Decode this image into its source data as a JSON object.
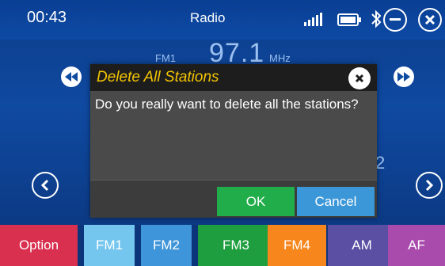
{
  "status_bar": {
    "time": "00:43",
    "title": "Radio",
    "icons": [
      "signal-icon",
      "battery-icon",
      "bluetooth-icon",
      "minimize-icon",
      "close-icon"
    ]
  },
  "radio": {
    "band": "FM1",
    "frequency": "97.1",
    "unit": "MHz",
    "bg_digit": "2"
  },
  "dialog": {
    "title": "Delete All Stations",
    "message": "Do you really want to delete all the stations?",
    "ok_label": "OK",
    "cancel_label": "Cancel"
  },
  "tabs": [
    {
      "label": "Option",
      "color": "#d9304f"
    },
    {
      "label": "FM1",
      "color": "#74c6ef",
      "selected": true
    },
    {
      "label": "FM2",
      "color": "#3f95d9"
    },
    {
      "label": "FM3",
      "color": "#1e9e3f"
    },
    {
      "label": "FM4",
      "color": "#f7861c"
    },
    {
      "label": "AM",
      "color": "#5b4fa4"
    },
    {
      "label": "AF",
      "color": "#a84bad"
    }
  ],
  "colors": {
    "title_accent": "#f4c400",
    "background": "#0f4aa1"
  }
}
